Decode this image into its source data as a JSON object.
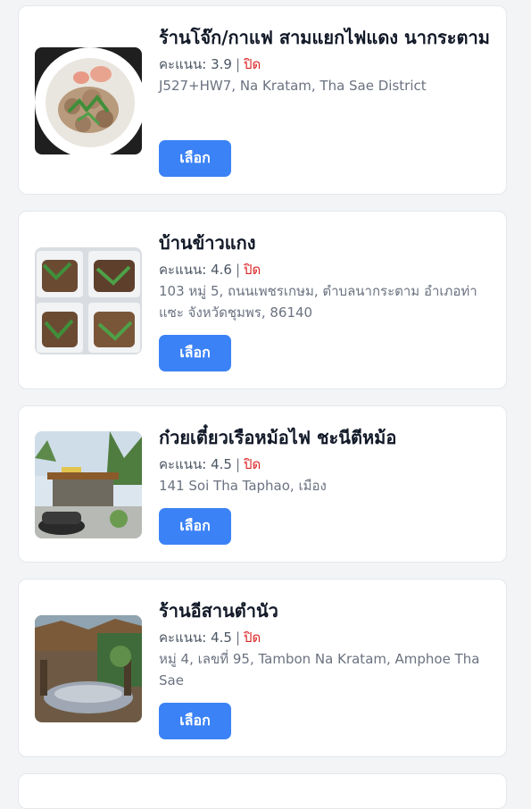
{
  "colors": {
    "page_bg": "#f3f4f6",
    "card_bg": "#ffffff",
    "button_bg": "#3b82f6",
    "status_closed": "#dc2626",
    "title": "#111827",
    "muted": "#6b7280"
  },
  "select_label": "เลือก",
  "rating_label": "คะแนน:",
  "restaurants": [
    {
      "name": "ร้านโจ๊ก/กาแฟ สามแยกไฟแดง นากระตาม",
      "rating": "3.9",
      "status": "ปิด",
      "address": "J527+HW7, Na Kratam, Tha Sae District",
      "image": "rice-porridge-bowl-photo"
    },
    {
      "name": "บ้านข้าวแกง",
      "rating": "4.6",
      "status": "ปิด",
      "address": "103 หมู่ 5, ถนนเพชรเกษม, ตำบลนากระตาม อำเภอท่าแซะ จังหวัดชุมพร, 86140",
      "image": "curry-rice-boxes-photo"
    },
    {
      "name": "ก๋วยเตี๋ยวเรือหม้อไฟ ชะนีตีหม้อ",
      "rating": "4.5",
      "status": "ปิด",
      "address": "141 Soi Tha Taphao, เมือง",
      "image": "roadside-shop-photo"
    },
    {
      "name": "ร้านอีสานตำนัว",
      "rating": "4.5",
      "status": "ปิด",
      "address": "หมู่ 4, เลขที่ 95, Tambon Na Kratam, Amphoe Tha Sae",
      "image": "dining-area-photo"
    }
  ]
}
